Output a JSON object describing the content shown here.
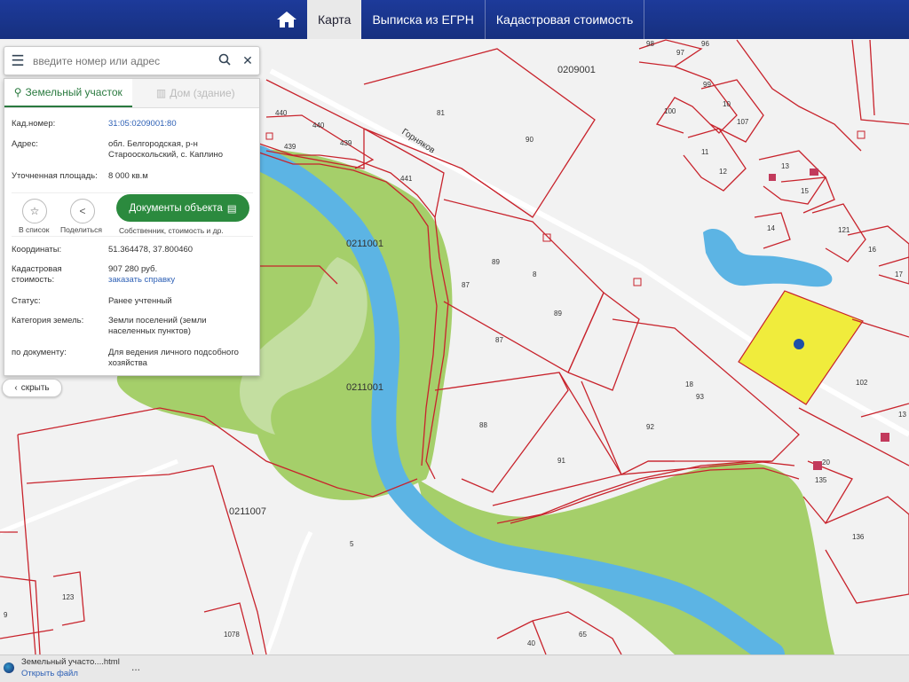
{
  "nav": {
    "home_icon": "home-icon",
    "tabs": [
      {
        "label": "Карта",
        "active": true
      },
      {
        "label": "Выписка из ЕГРН",
        "active": false
      },
      {
        "label": "Кадастровая стоимость",
        "active": false
      }
    ]
  },
  "search": {
    "placeholder": "введите номер или адрес",
    "menu_icon": "menu-icon",
    "search_icon": "search-icon",
    "close_icon": "close-icon"
  },
  "panel": {
    "tabs": [
      {
        "label": "Земельный участок",
        "active": true
      },
      {
        "label": "Дом (здание)",
        "active": false
      }
    ],
    "cadastral_number": {
      "label": "Кад.номер:",
      "value": "31:05:0209001:80"
    },
    "address": {
      "label": "Адрес:",
      "value": "обл. Белгородская, р-н Старооскольский, с. Каплино"
    },
    "area": {
      "label": "Уточненная площадь:",
      "value": "8 000 кв.м"
    },
    "actions": {
      "list_label": "В список",
      "share_label": "Поделиться",
      "docs_label": "Документы объекта",
      "docs_sub": "Собственник, стоимость и др."
    },
    "coords": {
      "label": "Координаты:",
      "value": "51.364478, 37.800460"
    },
    "cost": {
      "label": "Кадастровая стоимость:",
      "value": "907 280 руб.",
      "link": "заказать справку"
    },
    "status": {
      "label": "Статус:",
      "value": "Ранее учтенный"
    },
    "category": {
      "label": "Категория земель:",
      "value": "Земли поселений (земли населенных пунктов)"
    },
    "usage": {
      "label": "по документу:",
      "value": "Для ведения личного подсобного хозяйства"
    }
  },
  "hide_button": "скрыть",
  "map": {
    "street": "Горняков",
    "colors": {
      "water": "#5cb4e4",
      "green": "#a5cf6a",
      "parcel_line": "#c8232c",
      "selected": "#f0ec3c",
      "marker": "#1e4fa8"
    },
    "labels": {
      "q0209001": "0209001",
      "q0211001a": "0211001",
      "q0211001b": "0211001",
      "q0211007": "0211007",
      "p440a": "440",
      "p440b": "440",
      "p439a": "439",
      "p439b": "439",
      "p441": "441",
      "p81": "81",
      "p90": "90",
      "p89a": "89",
      "p89b": "89",
      "p87a": "87",
      "p87b": "87",
      "p8": "8",
      "p88": "88",
      "p91": "91",
      "p92": "92",
      "p93": "93",
      "p18": "18",
      "p102": "102",
      "p135": "135",
      "p136": "136",
      "p98": "98",
      "p97": "97",
      "p96": "96",
      "p99": "99",
      "p100": "100",
      "p10": "10",
      "p107": "107",
      "p11": "11",
      "p12": "12",
      "p13": "13",
      "p15": "15",
      "p14": "14",
      "p121": "121",
      "p16": "16",
      "p17": "17",
      "p13r": "13",
      "p5": "5",
      "p123": "123",
      "p1078": "1078",
      "p40": "40",
      "p65": "65",
      "p9": "9",
      "p20": "20"
    }
  },
  "taskbar": {
    "file_name": "Земельный участо....html",
    "open_label": "Открыть файл",
    "more_label": "..."
  }
}
